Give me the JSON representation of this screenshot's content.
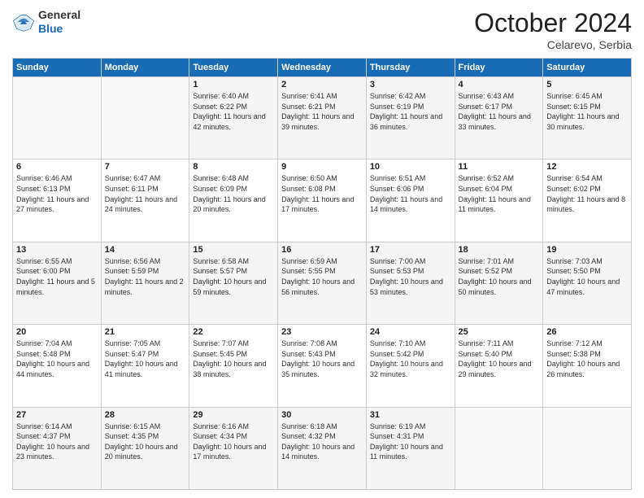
{
  "header": {
    "logo_general": "General",
    "logo_blue": "Blue",
    "month_title": "October 2024",
    "subtitle": "Celarevo, Serbia"
  },
  "weekdays": [
    "Sunday",
    "Monday",
    "Tuesday",
    "Wednesday",
    "Thursday",
    "Friday",
    "Saturday"
  ],
  "weeks": [
    [
      {
        "day": "",
        "sunrise": "",
        "sunset": "",
        "daylight": ""
      },
      {
        "day": "",
        "sunrise": "",
        "sunset": "",
        "daylight": ""
      },
      {
        "day": "1",
        "sunrise": "Sunrise: 6:40 AM",
        "sunset": "Sunset: 6:22 PM",
        "daylight": "Daylight: 11 hours and 42 minutes."
      },
      {
        "day": "2",
        "sunrise": "Sunrise: 6:41 AM",
        "sunset": "Sunset: 6:21 PM",
        "daylight": "Daylight: 11 hours and 39 minutes."
      },
      {
        "day": "3",
        "sunrise": "Sunrise: 6:42 AM",
        "sunset": "Sunset: 6:19 PM",
        "daylight": "Daylight: 11 hours and 36 minutes."
      },
      {
        "day": "4",
        "sunrise": "Sunrise: 6:43 AM",
        "sunset": "Sunset: 6:17 PM",
        "daylight": "Daylight: 11 hours and 33 minutes."
      },
      {
        "day": "5",
        "sunrise": "Sunrise: 6:45 AM",
        "sunset": "Sunset: 6:15 PM",
        "daylight": "Daylight: 11 hours and 30 minutes."
      }
    ],
    [
      {
        "day": "6",
        "sunrise": "Sunrise: 6:46 AM",
        "sunset": "Sunset: 6:13 PM",
        "daylight": "Daylight: 11 hours and 27 minutes."
      },
      {
        "day": "7",
        "sunrise": "Sunrise: 6:47 AM",
        "sunset": "Sunset: 6:11 PM",
        "daylight": "Daylight: 11 hours and 24 minutes."
      },
      {
        "day": "8",
        "sunrise": "Sunrise: 6:48 AM",
        "sunset": "Sunset: 6:09 PM",
        "daylight": "Daylight: 11 hours and 20 minutes."
      },
      {
        "day": "9",
        "sunrise": "Sunrise: 6:50 AM",
        "sunset": "Sunset: 6:08 PM",
        "daylight": "Daylight: 11 hours and 17 minutes."
      },
      {
        "day": "10",
        "sunrise": "Sunrise: 6:51 AM",
        "sunset": "Sunset: 6:06 PM",
        "daylight": "Daylight: 11 hours and 14 minutes."
      },
      {
        "day": "11",
        "sunrise": "Sunrise: 6:52 AM",
        "sunset": "Sunset: 6:04 PM",
        "daylight": "Daylight: 11 hours and 11 minutes."
      },
      {
        "day": "12",
        "sunrise": "Sunrise: 6:54 AM",
        "sunset": "Sunset: 6:02 PM",
        "daylight": "Daylight: 11 hours and 8 minutes."
      }
    ],
    [
      {
        "day": "13",
        "sunrise": "Sunrise: 6:55 AM",
        "sunset": "Sunset: 6:00 PM",
        "daylight": "Daylight: 11 hours and 5 minutes."
      },
      {
        "day": "14",
        "sunrise": "Sunrise: 6:56 AM",
        "sunset": "Sunset: 5:59 PM",
        "daylight": "Daylight: 11 hours and 2 minutes."
      },
      {
        "day": "15",
        "sunrise": "Sunrise: 6:58 AM",
        "sunset": "Sunset: 5:57 PM",
        "daylight": "Daylight: 10 hours and 59 minutes."
      },
      {
        "day": "16",
        "sunrise": "Sunrise: 6:59 AM",
        "sunset": "Sunset: 5:55 PM",
        "daylight": "Daylight: 10 hours and 56 minutes."
      },
      {
        "day": "17",
        "sunrise": "Sunrise: 7:00 AM",
        "sunset": "Sunset: 5:53 PM",
        "daylight": "Daylight: 10 hours and 53 minutes."
      },
      {
        "day": "18",
        "sunrise": "Sunrise: 7:01 AM",
        "sunset": "Sunset: 5:52 PM",
        "daylight": "Daylight: 10 hours and 50 minutes."
      },
      {
        "day": "19",
        "sunrise": "Sunrise: 7:03 AM",
        "sunset": "Sunset: 5:50 PM",
        "daylight": "Daylight: 10 hours and 47 minutes."
      }
    ],
    [
      {
        "day": "20",
        "sunrise": "Sunrise: 7:04 AM",
        "sunset": "Sunset: 5:48 PM",
        "daylight": "Daylight: 10 hours and 44 minutes."
      },
      {
        "day": "21",
        "sunrise": "Sunrise: 7:05 AM",
        "sunset": "Sunset: 5:47 PM",
        "daylight": "Daylight: 10 hours and 41 minutes."
      },
      {
        "day": "22",
        "sunrise": "Sunrise: 7:07 AM",
        "sunset": "Sunset: 5:45 PM",
        "daylight": "Daylight: 10 hours and 38 minutes."
      },
      {
        "day": "23",
        "sunrise": "Sunrise: 7:08 AM",
        "sunset": "Sunset: 5:43 PM",
        "daylight": "Daylight: 10 hours and 35 minutes."
      },
      {
        "day": "24",
        "sunrise": "Sunrise: 7:10 AM",
        "sunset": "Sunset: 5:42 PM",
        "daylight": "Daylight: 10 hours and 32 minutes."
      },
      {
        "day": "25",
        "sunrise": "Sunrise: 7:11 AM",
        "sunset": "Sunset: 5:40 PM",
        "daylight": "Daylight: 10 hours and 29 minutes."
      },
      {
        "day": "26",
        "sunrise": "Sunrise: 7:12 AM",
        "sunset": "Sunset: 5:38 PM",
        "daylight": "Daylight: 10 hours and 26 minutes."
      }
    ],
    [
      {
        "day": "27",
        "sunrise": "Sunrise: 6:14 AM",
        "sunset": "Sunset: 4:37 PM",
        "daylight": "Daylight: 10 hours and 23 minutes."
      },
      {
        "day": "28",
        "sunrise": "Sunrise: 6:15 AM",
        "sunset": "Sunset: 4:35 PM",
        "daylight": "Daylight: 10 hours and 20 minutes."
      },
      {
        "day": "29",
        "sunrise": "Sunrise: 6:16 AM",
        "sunset": "Sunset: 4:34 PM",
        "daylight": "Daylight: 10 hours and 17 minutes."
      },
      {
        "day": "30",
        "sunrise": "Sunrise: 6:18 AM",
        "sunset": "Sunset: 4:32 PM",
        "daylight": "Daylight: 10 hours and 14 minutes."
      },
      {
        "day": "31",
        "sunrise": "Sunrise: 6:19 AM",
        "sunset": "Sunset: 4:31 PM",
        "daylight": "Daylight: 10 hours and 11 minutes."
      },
      {
        "day": "",
        "sunrise": "",
        "sunset": "",
        "daylight": ""
      },
      {
        "day": "",
        "sunrise": "",
        "sunset": "",
        "daylight": ""
      }
    ]
  ]
}
